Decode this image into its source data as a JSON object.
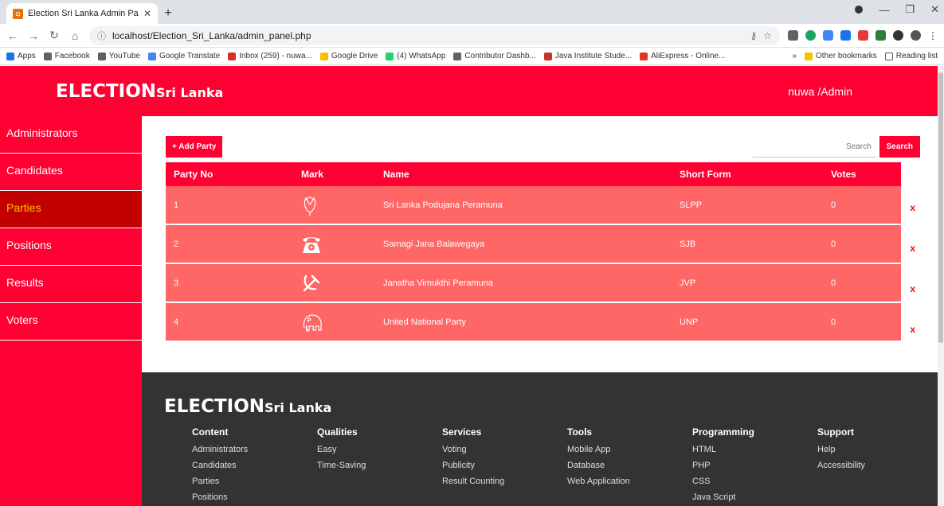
{
  "browser": {
    "tab_title": "Election Sri Lanka Admin Panel",
    "url": "localhost/Election_Sri_Lanka/admin_panel.php",
    "bookmarks": [
      {
        "label": "Apps",
        "color": "#1a73e8"
      },
      {
        "label": "Facebook",
        "color": "#5f6368"
      },
      {
        "label": "YouTube",
        "color": "#5f6368"
      },
      {
        "label": "Google Translate",
        "color": "#4285f4"
      },
      {
        "label": "Inbox (259) - nuwa...",
        "color": "#d93025"
      },
      {
        "label": "Google Drive",
        "color": "#fbbc04"
      },
      {
        "label": "(4) WhatsApp",
        "color": "#25d366"
      },
      {
        "label": "Contributor Dashb...",
        "color": "#5f6368"
      },
      {
        "label": "Java Institute Stude...",
        "color": "#c0392b"
      },
      {
        "label": "AliExpress - Online...",
        "color": "#e43225"
      }
    ],
    "other_bookmarks": "Other bookmarks",
    "reading_list": "Reading list"
  },
  "header": {
    "brand_main": "ELECTION",
    "brand_sub": "Sri Lanka",
    "user": "nuwa /Admin"
  },
  "sidebar": {
    "items": [
      {
        "label": "Administrators",
        "active": false
      },
      {
        "label": "Candidates",
        "active": false
      },
      {
        "label": "Parties",
        "active": true
      },
      {
        "label": "Positions",
        "active": false
      },
      {
        "label": "Results",
        "active": false
      },
      {
        "label": "Voters",
        "active": false
      }
    ]
  },
  "toolbar": {
    "add_label": "+ Add Party",
    "search_placeholder": "Search",
    "search_label": "Search"
  },
  "table": {
    "headers": [
      "Party No",
      "Mark",
      "Name",
      "Short Form",
      "Votes"
    ],
    "rows": [
      {
        "no": "1",
        "mark": "lotus-bud-icon",
        "name": "Sri Lanka Podujana Peramuna",
        "short": "SLPP",
        "votes": "0"
      },
      {
        "no": "2",
        "mark": "telephone-icon",
        "name": "Samagi Jana Balawegaya",
        "short": "SJB",
        "votes": "0"
      },
      {
        "no": "3",
        "mark": "hammer-sickle-icon",
        "name": "Janatha Vimukthi Peramuna",
        "short": "JVP",
        "votes": "0"
      },
      {
        "no": "4",
        "mark": "elephant-icon",
        "name": "United National Party",
        "short": "UNP",
        "votes": "0"
      }
    ],
    "delete_symbol": "x"
  },
  "footer": {
    "brand_main": "ELECTION",
    "brand_sub": "Sri Lanka",
    "columns": [
      {
        "title": "Content",
        "links": [
          "Administrators",
          "Candidates",
          "Parties",
          "Positions"
        ]
      },
      {
        "title": "Qualities",
        "links": [
          "Easy",
          "Time-Saving"
        ]
      },
      {
        "title": "Services",
        "links": [
          "Voting",
          "Publicity",
          "Result Counting"
        ]
      },
      {
        "title": "Tools",
        "links": [
          "Mobile App",
          "Database",
          "Web Application"
        ]
      },
      {
        "title": "Programming",
        "links": [
          "HTML",
          "PHP",
          "CSS",
          "Java Script"
        ]
      },
      {
        "title": "Support",
        "links": [
          "Help",
          "Accessibility"
        ]
      }
    ]
  },
  "colors": {
    "primary": "#ff0033",
    "active_bg": "#c30000",
    "active_text": "#ffc000",
    "row_bg": "#ff6666",
    "footer_bg": "#333333"
  }
}
